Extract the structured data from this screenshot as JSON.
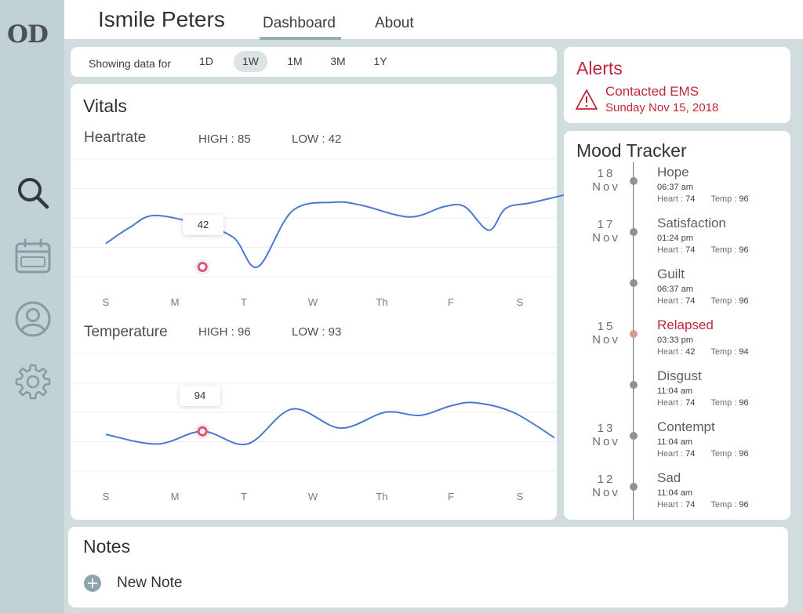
{
  "app": {
    "logo": "OD"
  },
  "header": {
    "patient_name": "Ismile Peters",
    "tabs": [
      {
        "label": "Dashboard",
        "active": true
      },
      {
        "label": "About",
        "active": false
      }
    ]
  },
  "sidebar": {
    "items": [
      {
        "icon": "search-icon"
      },
      {
        "icon": "calendar-icon"
      },
      {
        "icon": "user-icon"
      },
      {
        "icon": "gear-icon"
      }
    ]
  },
  "range": {
    "label": "Showing data for",
    "options": [
      "1D",
      "1W",
      "1M",
      "3M",
      "1Y"
    ],
    "selected": "1W"
  },
  "vitals": {
    "title": "Vitals",
    "heartrate": {
      "title": "Heartrate",
      "high": "HIGH : 85",
      "low": "LOW : 42",
      "tooltip": "42"
    },
    "temperature": {
      "title": "Temperature",
      "high": "HIGH : 96",
      "low": "LOW : 93",
      "tooltip": "94"
    }
  },
  "chart_data": [
    {
      "type": "line",
      "title": "Heartrate",
      "categories": [
        "S",
        "M",
        "T",
        "W",
        "Th",
        "F",
        "S"
      ],
      "x": [
        0,
        0.35,
        0.7,
        1.35,
        1.85,
        2.2,
        2.7,
        3.3,
        3.7,
        4.4,
        4.9,
        5.2,
        5.55,
        5.8,
        6.2,
        7
      ],
      "series": [
        {
          "values": [
            58,
            69,
            77,
            71,
            62,
            42,
            80,
            86,
            84,
            76,
            83,
            83,
            67,
            82,
            86,
            95,
            92
          ]
        }
      ],
      "marker": {
        "x": 1.4,
        "value": 42
      },
      "line_color": "#4a78d2",
      "marker_color": "#d6587a"
    },
    {
      "type": "line",
      "title": "Temperature",
      "categories": [
        "S",
        "M",
        "T",
        "W",
        "Th",
        "F",
        "S"
      ],
      "x": [
        0,
        0.75,
        1.4,
        2.05,
        2.7,
        3.4,
        4.05,
        4.55,
        5.0,
        5.35,
        5.9,
        6.5
      ],
      "series": [
        {
          "values": [
            93.9,
            93.6,
            94.0,
            93.6,
            94.7,
            94.1,
            94.6,
            94.5,
            94.8,
            94.9,
            94.6,
            93.8
          ]
        }
      ],
      "marker": {
        "x": 1.4,
        "value": 94
      },
      "line_color": "#4a78d2",
      "marker_color": "#d6587a"
    }
  ],
  "alerts": {
    "title": "Alerts",
    "items": [
      {
        "text": "Contacted EMS",
        "date": "Sunday Nov 15, 2018",
        "icon": "warning-icon"
      }
    ]
  },
  "mood": {
    "title": "Mood Tracker",
    "entries": [
      {
        "day": "18",
        "month": "Nov",
        "name": "Hope",
        "time": "06:37 am",
        "heart_label": "Heart :",
        "heart": "74",
        "temp_label": "Temp :",
        "temp": "96",
        "alert": false
      },
      {
        "day": "17",
        "month": "Nov",
        "name": "Satisfaction",
        "time": "01:24 pm",
        "heart_label": "Heart :",
        "heart": "74",
        "temp_label": "Temp :",
        "temp": "96",
        "alert": false
      },
      {
        "day": "",
        "month": "",
        "name": "Guilt",
        "time": "06:37 am",
        "heart_label": "Heart :",
        "heart": "74",
        "temp_label": "Temp :",
        "temp": "96",
        "alert": false
      },
      {
        "day": "15",
        "month": "Nov",
        "name": "Relapsed",
        "time": "03:33 pm",
        "heart_label": "Heart :",
        "heart": "42",
        "temp_label": "Temp :",
        "temp": "94",
        "alert": true
      },
      {
        "day": "",
        "month": "",
        "name": "Disgust",
        "time": "11:04 am",
        "heart_label": "Heart :",
        "heart": "74",
        "temp_label": "Temp :",
        "temp": "96",
        "alert": false
      },
      {
        "day": "13",
        "month": "Nov",
        "name": "Contempt",
        "time": "11:04 am",
        "heart_label": "Heart :",
        "heart": "74",
        "temp_label": "Temp :",
        "temp": "96",
        "alert": false
      },
      {
        "day": "12",
        "month": "Nov",
        "name": "Sad",
        "time": "11:04 am",
        "heart_label": "Heart :",
        "heart": "74",
        "temp_label": "Temp :",
        "temp": "96",
        "alert": false
      }
    ]
  },
  "notes": {
    "title": "Notes",
    "add_label": "New Note"
  },
  "colors": {
    "alert": "#c0273c",
    "accent_bar": "#9aacb4",
    "sidebar": "#c1d2d6"
  }
}
